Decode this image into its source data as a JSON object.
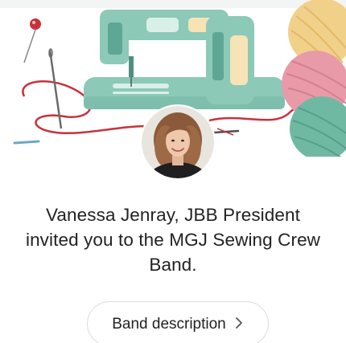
{
  "invite": {
    "inviter_name": "Vanessa Jenray, JBB President",
    "message_line": "invited you to the MGJ Sewing Crew Band."
  },
  "band_description_button": {
    "label": "Band description"
  },
  "icons": {
    "chevron": "chevron-right-icon"
  },
  "colors": {
    "machine_teal": "#8cc9b7",
    "machine_dark": "#5fa795",
    "yarn_pink": "#e89aa8",
    "yarn_yellow": "#f1d08a",
    "yarn_green": "#6fb9a3",
    "thread_red": "#c8323c",
    "text": "#222222"
  }
}
